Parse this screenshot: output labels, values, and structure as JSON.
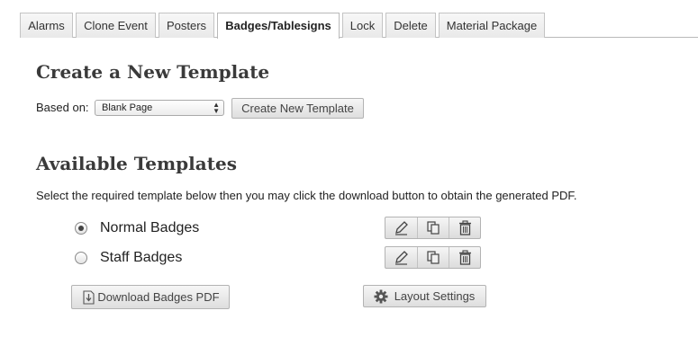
{
  "tabs": [
    {
      "label": "Alarms",
      "active": false
    },
    {
      "label": "Clone Event",
      "active": false
    },
    {
      "label": "Posters",
      "active": false
    },
    {
      "label": "Badges/Tablesigns",
      "active": true
    },
    {
      "label": "Lock",
      "active": false
    },
    {
      "label": "Delete",
      "active": false
    },
    {
      "label": "Material Package",
      "active": false
    }
  ],
  "create_section": {
    "title": "Create a New Template",
    "based_on_label": "Based on:",
    "selected_option": "Blank Page",
    "create_button": "Create New Template"
  },
  "available_section": {
    "title": "Available Templates",
    "instructions": "Select the required template below then you may click the download button to obtain the generated PDF.",
    "templates": [
      {
        "name": "Normal Badges",
        "selected": true,
        "actions": [
          "edit-icon",
          "copy-icon",
          "delete-icon"
        ]
      },
      {
        "name": "Staff Badges",
        "selected": false,
        "actions": [
          "edit-icon",
          "copy-icon",
          "delete-icon"
        ]
      }
    ],
    "download_button": "Download Badges PDF",
    "download_icon": "download-file-icon",
    "layout_button": "Layout Settings",
    "layout_icon": "gear-icon"
  }
}
